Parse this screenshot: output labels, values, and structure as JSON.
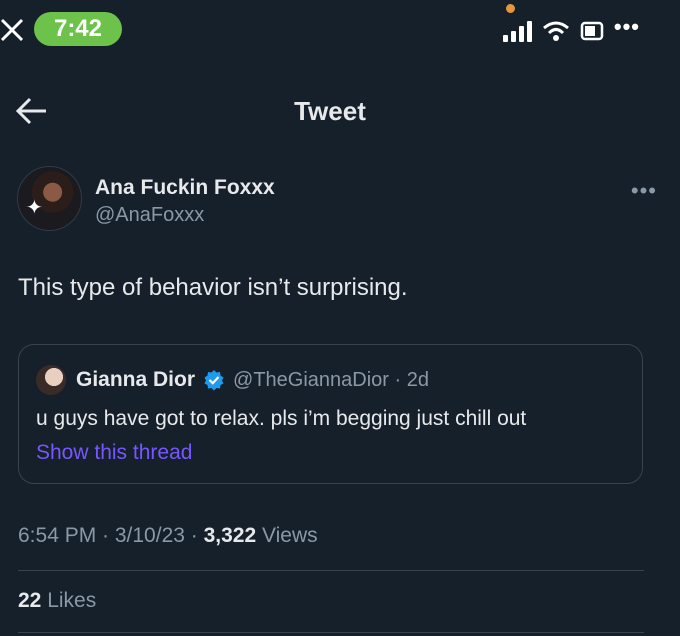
{
  "status_bar": {
    "time": "7:42",
    "more": "•••"
  },
  "header": {
    "title": "Tweet"
  },
  "tweet": {
    "author_name": "Ana Fuckin Foxxx",
    "author_handle": "@AnaFoxxx",
    "more": "•••",
    "text": "This type of behavior isn’t surprising.",
    "quote": {
      "name": "Gianna Dior",
      "handle_time": "@TheGiannaDior · 2d",
      "text": "u guys have got to relax. pls i’m begging just chill out",
      "link": "Show this thread"
    },
    "meta": {
      "time_date": "6:54 PM · 3/10/23 · ",
      "views_count": "3,322",
      "views_label": " Views"
    },
    "likes": {
      "count": "22",
      "label": " Likes"
    }
  },
  "colors": {
    "background": "#15202b",
    "accent_link": "#7856ff",
    "time_pill": "#6cc24a",
    "verified": "#1d9bf0"
  }
}
